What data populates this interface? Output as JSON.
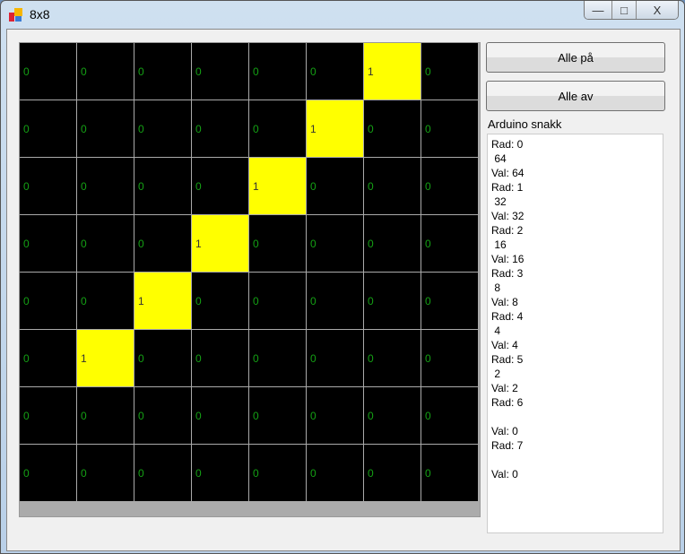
{
  "window": {
    "title": "8x8",
    "minimize": "—",
    "maximize": "□",
    "close": "X"
  },
  "grid": [
    [
      "0",
      "0",
      "0",
      "0",
      "0",
      "0",
      "1",
      "0"
    ],
    [
      "0",
      "0",
      "0",
      "0",
      "0",
      "1",
      "0",
      "0"
    ],
    [
      "0",
      "0",
      "0",
      "0",
      "1",
      "0",
      "0",
      "0"
    ],
    [
      "0",
      "0",
      "0",
      "1",
      "0",
      "0",
      "0",
      "0"
    ],
    [
      "0",
      "0",
      "1",
      "0",
      "0",
      "0",
      "0",
      "0"
    ],
    [
      "0",
      "1",
      "0",
      "0",
      "0",
      "0",
      "0",
      "0"
    ],
    [
      "0",
      "0",
      "0",
      "0",
      "0",
      "0",
      "0",
      "0"
    ],
    [
      "0",
      "0",
      "0",
      "0",
      "0",
      "0",
      "0",
      "0"
    ]
  ],
  "colors": {
    "on": "#ffff00",
    "off": "#000000",
    "text": "#14a014"
  },
  "buttons": {
    "all_on": "Alle på",
    "all_off": "Alle av"
  },
  "log_label": "Arduino snakk",
  "log": [
    "Rad: 0",
    " 64",
    "Val: 64",
    "Rad: 1",
    " 32",
    "Val: 32",
    "Rad: 2",
    " 16",
    "Val: 16",
    "Rad: 3",
    " 8",
    "Val: 8",
    "Rad: 4",
    " 4",
    "Val: 4",
    "Rad: 5",
    " 2",
    "Val: 2",
    "Rad: 6",
    "",
    "Val: 0",
    "Rad: 7",
    "",
    "Val: 0"
  ]
}
